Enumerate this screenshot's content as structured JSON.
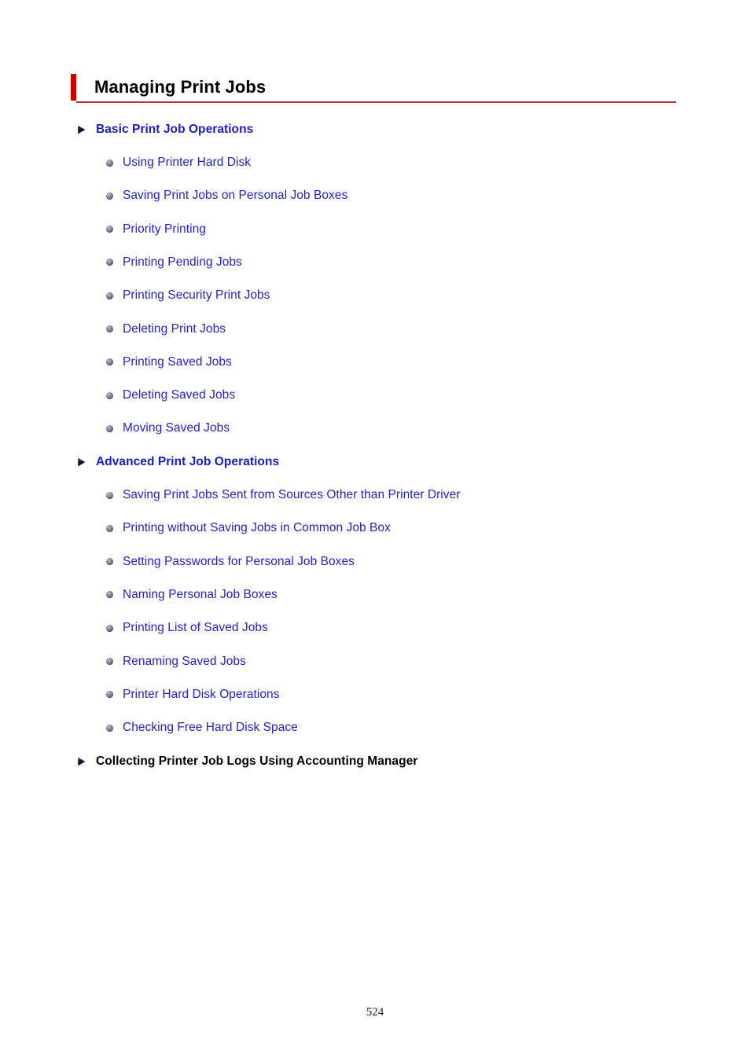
{
  "page": {
    "title": "Managing Print Jobs",
    "number": "524",
    "accent_color": "#cc0000",
    "rule_color": "#c0282c",
    "link_color": "#2222cc",
    "heading_color": "#1a1ac8",
    "text_color": "#000000"
  },
  "sections": [
    {
      "heading": "Basic Print Job Operations",
      "heading_is_link": true,
      "marker": "arrow-right-icon",
      "items": [
        "Using Printer Hard Disk",
        "Saving Print Jobs on Personal Job Boxes",
        "Priority Printing",
        "Printing Pending Jobs",
        "Printing Security Print Jobs",
        "Deleting Print Jobs",
        "Printing Saved Jobs",
        "Deleting Saved Jobs",
        "Moving Saved Jobs"
      ]
    },
    {
      "heading": "Advanced Print Job Operations",
      "heading_is_link": true,
      "marker": "arrow-right-icon",
      "items": [
        "Saving Print Jobs Sent from Sources Other than Printer Driver",
        "Printing without Saving Jobs in Common Job Box",
        "Setting Passwords for Personal Job Boxes",
        "Naming Personal Job Boxes",
        "Printing List of Saved Jobs",
        "Renaming Saved Jobs",
        "Printer Hard Disk Operations",
        "Checking Free Hard Disk Space"
      ]
    },
    {
      "heading": "Collecting Printer Job Logs Using Accounting Manager",
      "heading_is_link": false,
      "marker": "arrow-right-icon",
      "items": []
    }
  ]
}
